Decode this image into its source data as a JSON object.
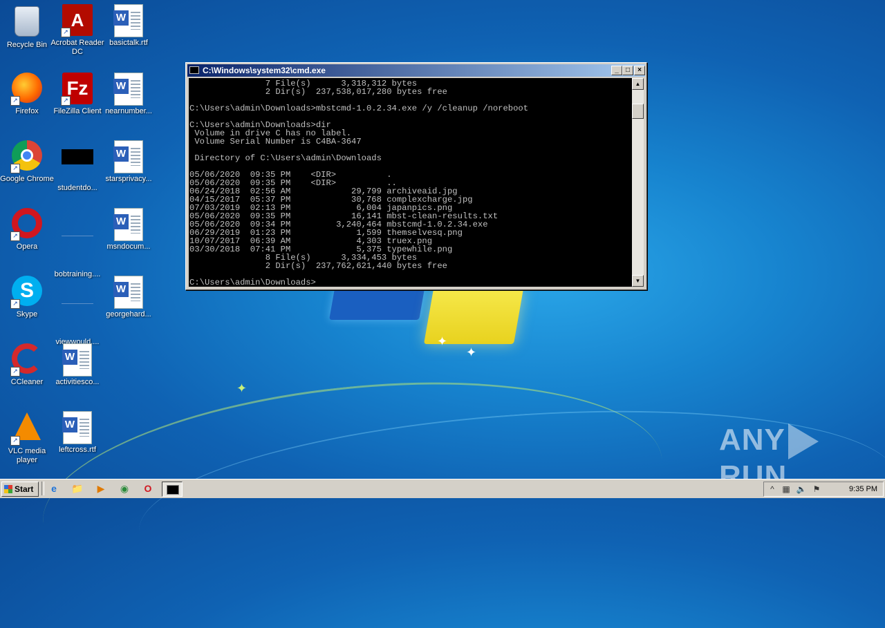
{
  "desktop": {
    "icons": [
      {
        "label": "Recycle Bin"
      },
      {
        "label": "Acrobat Reader DC"
      },
      {
        "label": "basictalk.rtf"
      },
      {
        "label": "Firefox"
      },
      {
        "label": "FileZilla Client"
      },
      {
        "label": "nearnumber..."
      },
      {
        "label": "Google Chrome"
      },
      {
        "label": "studentdo..."
      },
      {
        "label": "starsprivacy..."
      },
      {
        "label": "Opera"
      },
      {
        "label": "bobtraining...."
      },
      {
        "label": "msndocum..."
      },
      {
        "label": "Skype"
      },
      {
        "label": "viewwould...."
      },
      {
        "label": "georgehard..."
      },
      {
        "label": "CCleaner"
      },
      {
        "label": "activitiesco..."
      },
      {
        "label": "VLC media player"
      },
      {
        "label": "leftcross.rtf"
      }
    ],
    "acrobat_glyph": "A",
    "word_glyph": "W",
    "filezilla_glyph": "Fz",
    "skype_glyph": "S",
    "shortcut_glyph": "↗",
    "watermark": {
      "left": "ANY",
      "right": "RUN"
    }
  },
  "cmd_window": {
    "title": "C:\\Windows\\system32\\cmd.exe",
    "buttons": {
      "minimize": "_",
      "maximize": "□",
      "close": "×"
    },
    "scroll_up": "▲",
    "scroll_down": "▼",
    "output": "               7 File(s)      3,318,312 bytes\n               2 Dir(s)  237,538,017,280 bytes free\n\nC:\\Users\\admin\\Downloads>mbstcmd-1.0.2.34.exe /y /cleanup /noreboot\n\nC:\\Users\\admin\\Downloads>dir\n Volume in drive C has no label.\n Volume Serial Number is C4BA-3647\n\n Directory of C:\\Users\\admin\\Downloads\n\n05/06/2020  09:35 PM    <DIR>          .\n05/06/2020  09:35 PM    <DIR>          ..\n06/24/2018  02:56 AM            29,799 archiveaid.jpg\n04/15/2017  05:37 PM            30,768 complexcharge.jpg\n07/03/2019  02:13 PM             6,004 japanpics.png\n05/06/2020  09:35 PM            16,141 mbst-clean-results.txt\n05/06/2020  09:34 PM         3,240,464 mbstcmd-1.0.2.34.exe\n06/29/2019  01:23 PM             1,599 themselvesq.png\n10/07/2017  06:39 AM             4,303 truex.png\n03/30/2018  07:41 PM             5,375 typewhile.png\n               8 File(s)      3,334,453 bytes\n               2 Dir(s)  237,762,621,440 bytes free\n\nC:\\Users\\admin\\Downloads>"
  },
  "taskbar": {
    "start_label": "Start",
    "clock": "9:35 PM",
    "tray_glyphs": {
      "expand": "^",
      "network": "▦",
      "volume": "🔈",
      "flag": "⚑"
    },
    "quicklaunch_glyphs": {
      "ie": "e",
      "explorer": "📁",
      "media": "▶",
      "chrome": "◉",
      "opera": "O"
    }
  }
}
